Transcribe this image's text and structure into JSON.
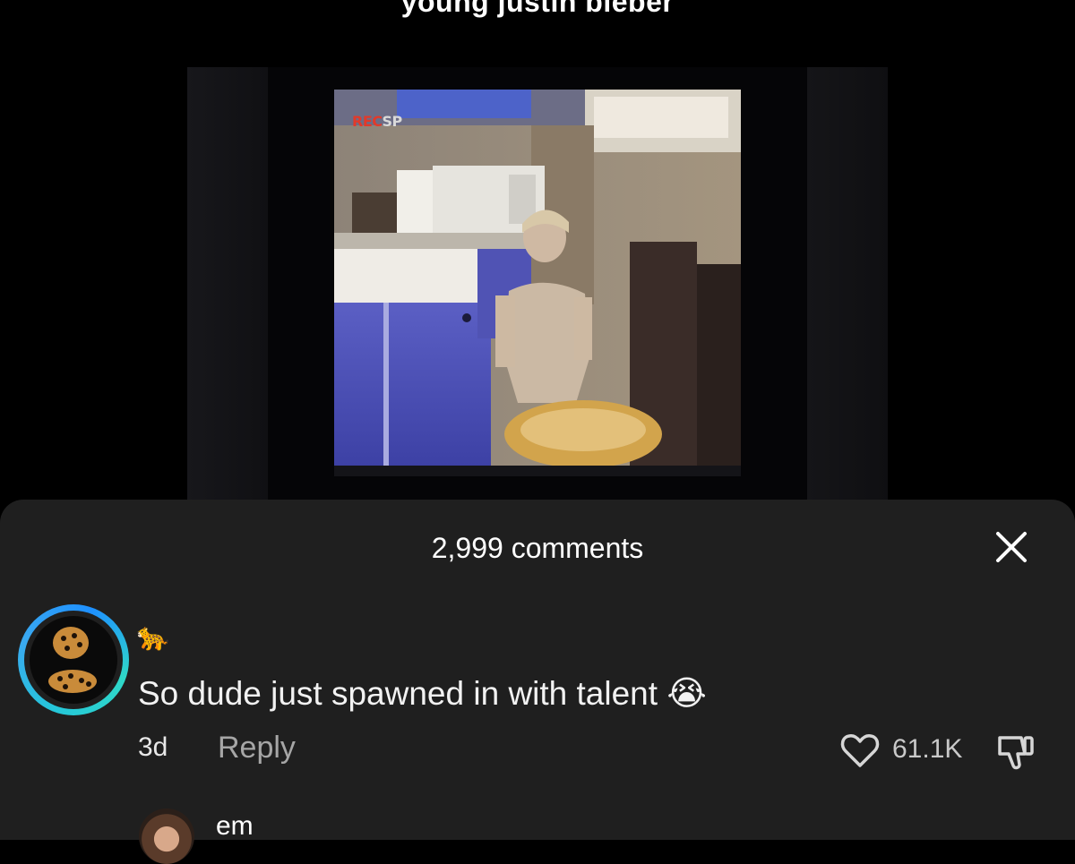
{
  "video": {
    "caption": "young justin bieber",
    "rec_label": "REC",
    "mode_label": "SP"
  },
  "comments_sheet": {
    "title": "2,999 comments",
    "comments": [
      {
        "username": "🐆",
        "text": "So dude just spawned in with talent",
        "emoji": "😭",
        "time": "3d",
        "reply_label": "Reply",
        "like_count": "61.1K"
      }
    ],
    "next_comment": {
      "username": "em"
    }
  },
  "icons": {
    "close": "close-icon",
    "like": "heart-outline-icon",
    "dislike": "thumbs-down-icon"
  },
  "colors": {
    "sheet_background": "#1f1f1f",
    "avatar_ring": "#25c7d9",
    "secondary_text": "#a6a6a6"
  }
}
